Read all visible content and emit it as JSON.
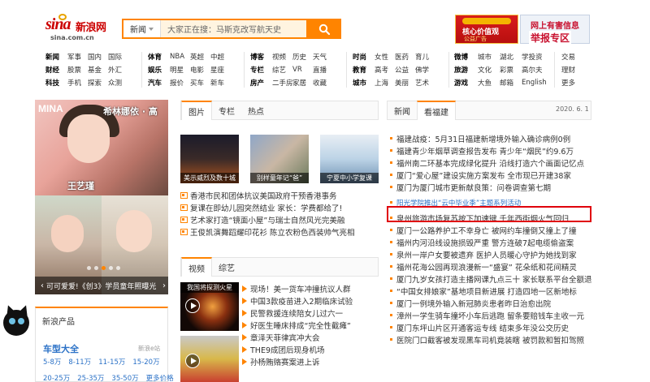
{
  "header": {
    "logo_mark": "sina",
    "logo_cn": "新浪网",
    "logo_url": "sina.com.cn",
    "search": {
      "category": "新闻",
      "placeholder": "大家正在搜：马斯克改写航天史"
    },
    "ad_left": {
      "line1": "核心价值观",
      "line2": "公益广告"
    },
    "ad_right": {
      "line1": "网上有害信息",
      "line2": "举报专区"
    }
  },
  "nav": {
    "groups": [
      {
        "rows": [
          [
            "新闻",
            "军事",
            "国内",
            "国际"
          ],
          [
            "财经",
            "股票",
            "基金",
            "外汇"
          ],
          [
            "科技",
            "手机",
            "探索",
            "众测"
          ]
        ]
      },
      {
        "rows": [
          [
            "体育",
            "NBA",
            "英超",
            "中超"
          ],
          [
            "娱乐",
            "明星",
            "电影",
            "星座"
          ],
          [
            "汽车",
            "报价",
            "买车",
            "新车"
          ]
        ]
      },
      {
        "rows": [
          [
            "博客",
            "视频",
            "历史",
            "天气"
          ],
          [
            "专栏",
            "综艺",
            "VR",
            "直播"
          ],
          [
            "房产",
            "二手房",
            "家居",
            "收藏"
          ]
        ]
      },
      {
        "rows": [
          [
            "时尚",
            "女性",
            "医药",
            "育儿"
          ],
          [
            "教育",
            "高考",
            "公益",
            "佛学"
          ],
          [
            "城市",
            "上海",
            "美丽",
            "艺术"
          ]
        ]
      },
      {
        "rows": [
          [
            "微博",
            "城市",
            "湖北",
            "学投资"
          ],
          [
            "旅游",
            "文化",
            "彩票",
            "高尔夫"
          ],
          [
            "游戏",
            "大鱼",
            "邮箱",
            "English"
          ]
        ]
      },
      {
        "rows": [
          [
            "交易"
          ],
          [
            "理财"
          ],
          [
            "更多"
          ]
        ]
      }
    ]
  },
  "slideshow": {
    "top_caption": "希林娜依 · 高",
    "name_overlay": "王艺瑾",
    "hat_text": "MINA",
    "caption": "可可爱爱!《创3》学员童年照曝光"
  },
  "products": {
    "title": "新浪产品",
    "subtitle": "车型大全",
    "tag": "新浪e站",
    "row1": [
      "5-8万",
      "8-11万",
      "11-15万",
      "15-20万"
    ],
    "row2": [
      "20-25万",
      "25-35万",
      "35-50万",
      "更多价格"
    ]
  },
  "picture_tabs": [
    "图片",
    "专栏",
    "热点"
  ],
  "thumbs": [
    {
      "caption": "美示威烈及数十城"
    },
    {
      "caption": "别样童年记“爸”"
    },
    {
      "caption": "宁夏中小学复课"
    }
  ],
  "picture_news": [
    "香港市民和团体抗议美国政府干预香港事务",
    "复课在即幼儿园突然结业 家长：学费都给了!",
    "艺术家打造“镜面小屋”与瑞士自然风光完美融",
    "王俊凯演舞蹈耀印花衫 陈立农粉色西装帅气亮相"
  ],
  "video_tabs": [
    "视频",
    "综艺"
  ],
  "video_thumbs": [
    {
      "caption": "我国将探测火星"
    }
  ],
  "video_news": [
    "现场！美一货车冲撞抗议人群",
    "中国3款疫苗进入2期临床试验",
    "民警救援连续陪女儿过六一",
    "好医生睡床排成“完全性截瘫”",
    "章泽天菲律宾冲大会",
    "THE9成团后现身机场",
    "孙杨贿赂赛案进上诉"
  ],
  "right_tabs": [
    "新闻",
    "看福建"
  ],
  "date": "2020. 6. 1",
  "right_news": [
    "福建战疫：5月31日福建新增境外输入确诊病例0例",
    "福建青少年烟草调查报告发布 青少年“烟民”约9.6万",
    "福州南二环基本完成绿化提升 沿线打造六个画面记忆点",
    "厦门“爱心屋”建设实施方案发布 全市现已开建38家",
    "厦门为厦门城市更新献良策：问卷调查第七期",
    "阳光学院推出“云中毕业季”主题系列活动",
    "泉州旅游市场复苏按下加速键 千年西街烟火气回归",
    "厦门一公路养护工不幸身亡 被网约车撞倒又撞上了撞",
    "福州内河沿线设施损毁严重 警方连破7起电缆偷盗案",
    "泉州一岸户女要被遗弃 医护人员暖心守护为她找到家",
    "福州花海公园再现浪漫新一“盛宴” 花朵纸和花间精灵",
    "厦门九岁女孩打造主播网课九点三十 家长联系平台全额退款",
    "“中国女排娘家”基地项目新进展 打造四地一区新地标",
    "厦门一例境外输入新冠肺炎患者昨日治愈出院",
    "漳州一学生骑车撞坏小车后逃跑 留条要赔钱车主收一元",
    "厦门东坪山片区开通客运专线 结束多年没公交历史",
    "医院门口截客被发现黑车司机竟装瞎 被罚款和暂扣驾照"
  ],
  "highlight_index": 5,
  "colors": {
    "accent": "#ff8400",
    "link_blue": "#2c72c7",
    "highlight_red": "#e0000b",
    "brand_red": "#cc0000"
  }
}
